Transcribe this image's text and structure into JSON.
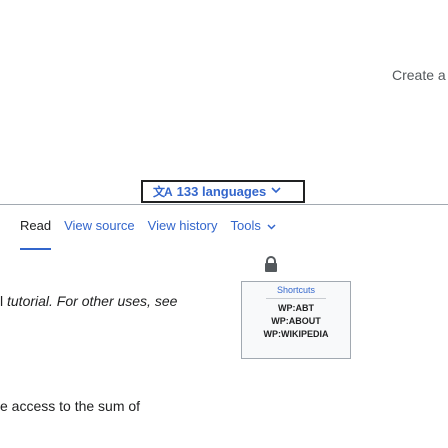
{
  "header": {
    "create_account": "Create a"
  },
  "languages": {
    "icon": "文A",
    "label": "133 languages",
    "chevron": "⌄"
  },
  "tabs": [
    {
      "label": "Read",
      "active": true
    },
    {
      "label": "View source",
      "active": false
    },
    {
      "label": "View history",
      "active": false
    },
    {
      "label": "Tools",
      "active": false,
      "dropdown": true
    }
  ],
  "tools_chevron": "∨",
  "content": {
    "line1_italic": "tutorial. For other uses, see",
    "line1_prefix": "l ",
    "line2": "e access to the sum of"
  },
  "shortcut_box": {
    "title": "Shortcuts",
    "items": [
      "WP:ABT",
      "WP:ABOUT",
      "WP:WIKIPEDIA"
    ]
  },
  "icons": {
    "lock": "lock-icon",
    "translate": "translate-icon"
  },
  "colors": {
    "link": "#3366cc",
    "text": "#202122",
    "border": "#a2a9b1"
  }
}
